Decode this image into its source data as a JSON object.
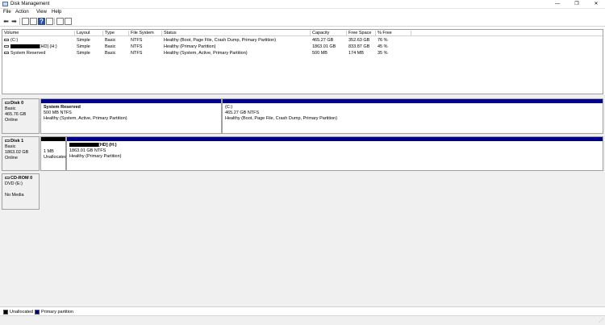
{
  "window": {
    "title": "Disk Management",
    "min_glyph": "—",
    "max_glyph": "❐",
    "close_glyph": "✕"
  },
  "menu": [
    "File",
    "Action",
    "View",
    "Help"
  ],
  "toolbar": {
    "back_glyph": "⬅",
    "forward_glyph": "➡",
    "help_glyph": "?"
  },
  "volume_table": {
    "headers": [
      "Volume",
      "Layout",
      "Type",
      "File System",
      "Status",
      "Capacity",
      "Free Space",
      "% Free"
    ],
    "rows": [
      {
        "volume": "(C:)",
        "layout": "Simple",
        "type": "Basic",
        "fs": "NTFS",
        "status": "Healthy (Boot, Page File, Crash Dump, Primary Partition)",
        "capacity": "465.27 GB",
        "free": "352.63 GB",
        "pct": "76 %"
      },
      {
        "volume": "[HD] (H:)",
        "layout": "Simple",
        "type": "Basic",
        "fs": "NTFS",
        "status": "Healthy (Primary Partition)",
        "capacity": "1863.01 GB",
        "free": "833.87 GB",
        "pct": "45 %"
      },
      {
        "volume": "System Reserved",
        "layout": "Simple",
        "type": "Basic",
        "fs": "NTFS",
        "status": "Healthy (System, Active, Primary Partition)",
        "capacity": "500 MB",
        "free": "174 MB",
        "pct": "35 %"
      }
    ]
  },
  "disks": [
    {
      "name": "Disk 0",
      "type": "Basic",
      "size": "465.76 GB",
      "status": "Online",
      "partitions": [
        {
          "name": "System Reserved",
          "size": "500 MB NTFS",
          "status": "Healthy (System, Active, Primary Partition)"
        },
        {
          "name": "(C:)",
          "size": "465.27 GB NTFS",
          "status": "Healthy (Boot, Page File, Crash Dump, Primary Partition)"
        }
      ]
    },
    {
      "name": "Disk 1",
      "type": "Basic",
      "size": "1863.02 GB",
      "status": "Online",
      "partitions": [
        {
          "size": "1 MB",
          "status": "Unallocated"
        },
        {
          "name": "[HD] (H:)",
          "size": "1863.01 GB NTFS",
          "status": "Healthy (Primary Partition)"
        }
      ]
    },
    {
      "name": "CD-ROM 0",
      "type": "DVD (E:)",
      "status": "No Media"
    }
  ],
  "legend": [
    {
      "label": "Unallocated",
      "color": "#000000"
    },
    {
      "label": "Primary partition",
      "color": "#00008b"
    }
  ],
  "statusbar": {
    "grip_glyph": "⋰"
  }
}
